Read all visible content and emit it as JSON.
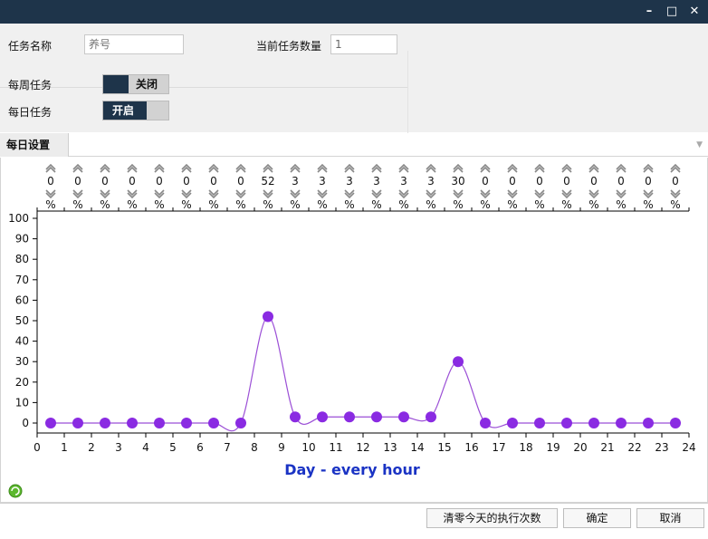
{
  "window": {
    "controls": {
      "minimize": "–",
      "maximize": "□",
      "close": "✕"
    }
  },
  "form": {
    "task_name_label": "任务名称",
    "task_name_placeholder": "养号",
    "task_count_label": "当前任务数量",
    "task_count_value": "1",
    "weekly_label": "每周任务",
    "weekly_state": "关闭",
    "daily_label": "每日任务",
    "daily_state": "开启"
  },
  "tabs": {
    "active": "每日设置"
  },
  "chart_data": {
    "type": "line",
    "title": "",
    "xlabel": "Day - every hour",
    "ylabel": "",
    "x_ticks": [
      0,
      1,
      2,
      3,
      4,
      5,
      6,
      7,
      8,
      9,
      10,
      11,
      12,
      13,
      14,
      15,
      16,
      17,
      18,
      19,
      20,
      21,
      22,
      23,
      24
    ],
    "y_ticks": [
      0,
      10,
      20,
      30,
      40,
      50,
      60,
      70,
      80,
      90,
      100
    ],
    "ylim": [
      0,
      100
    ],
    "xlim": [
      0,
      24
    ],
    "x": [
      0.5,
      1.5,
      2.5,
      3.5,
      4.5,
      5.5,
      6.5,
      7.5,
      8.5,
      9.5,
      10.5,
      11.5,
      12.5,
      13.5,
      14.5,
      15.5,
      16.5,
      17.5,
      18.5,
      19.5,
      20.5,
      21.5,
      22.5,
      23.5
    ],
    "values": [
      0,
      0,
      0,
      0,
      0,
      0,
      0,
      0,
      52,
      3,
      3,
      3,
      3,
      3,
      3,
      30,
      0,
      0,
      0,
      0,
      0,
      0,
      0,
      0
    ],
    "percent_unit": "%",
    "line_color": "#9b4fd6",
    "point_color": "#8a2be2",
    "xlabel_color": "#1a33c4"
  },
  "footer": {
    "reset_label": "清零今天的执行次数",
    "ok_label": "确定",
    "cancel_label": "取消"
  }
}
